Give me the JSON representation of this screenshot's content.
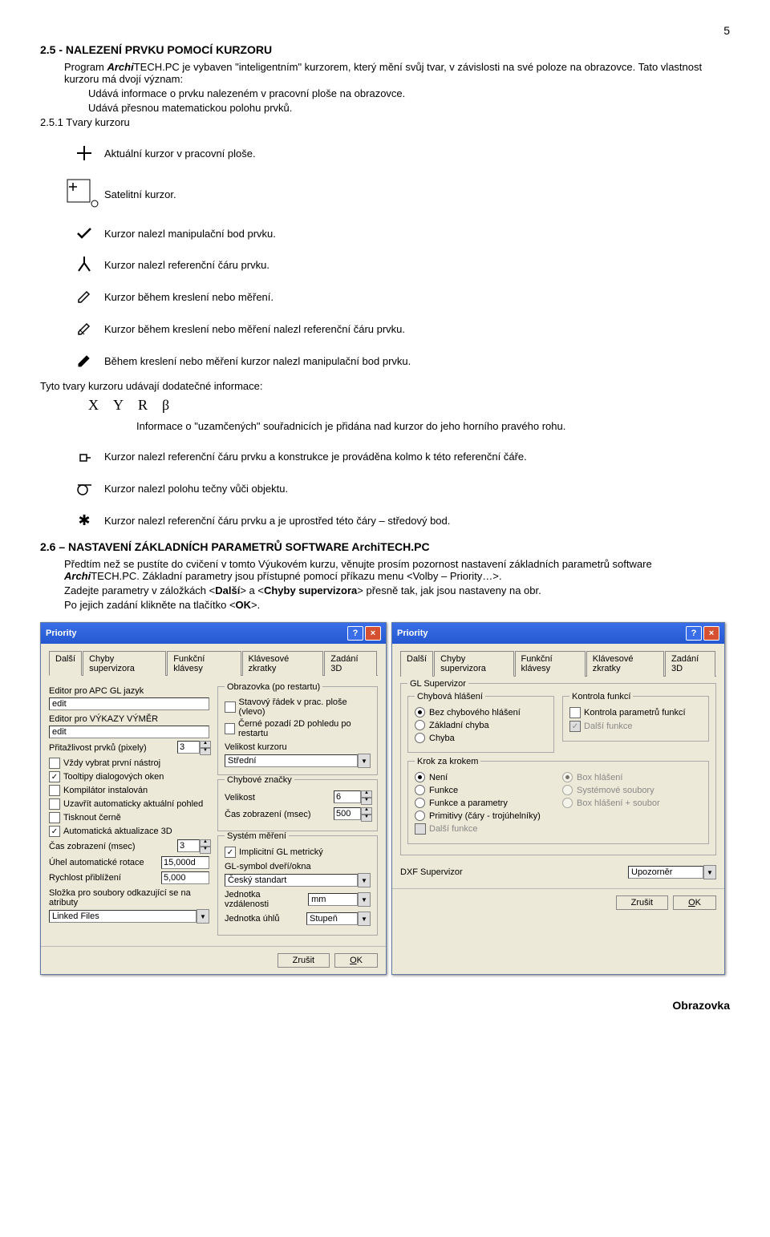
{
  "page_number": "5",
  "section_2_5": {
    "heading": "2.5 - NALEZENÍ PRVKU POMOCÍ KURZORU",
    "para1a": "Program ",
    "para1b": "Archi",
    "para1c": "TECH.PC je vybaven \"inteligentním\" kurzorem, který mění svůj tvar, v závislosti na své poloze na obrazovce. Tato vlastnost kurzoru má dvojí význam:",
    "bullet1": "Udává informace o prvku nalezeném v pracovní ploše na obrazovce.",
    "bullet2": "Udává přesnou matematickou polohu prvků.",
    "sub_heading": "2.5.1 Tvary kurzoru",
    "cursors": [
      "Aktuální kurzor v pracovní ploše.",
      "Satelitní kurzor.",
      "Kurzor nalezl manipulační bod prvku.",
      "Kurzor nalezl referenční čáru prvku.",
      "Kurzor během kreslení nebo měření.",
      "Kurzor během kreslení nebo měření nalezl referenční čáru prvku.",
      "Během kreslení nebo měření kurzor nalezl manipulační bod prvku."
    ],
    "info_line": "Tyto tvary kurzoru udávají dodatečné informace:",
    "info_icons": [
      "X",
      "Y",
      "R",
      "β"
    ],
    "info_desc": "Informace o \"uzamčených\" souřadnicích je přidána nad kurzor do jeho horního pravého rohu.",
    "extra": [
      "Kurzor nalezl referenční čáru prvku a konstrukce je prováděna kolmo k této referenční čáře.",
      "Kurzor nalezl polohu tečny vůči objektu.",
      "Kurzor nalezl referenční čáru prvku a je uprostřed této čáry – středový bod."
    ]
  },
  "section_2_6": {
    "heading": "2.6 – NASTAVENÍ ZÁKLADNÍCH PARAMETRŮ SOFTWARE ArchiTECH.PC",
    "para_a": "Předtím než se pustíte do cvičení v tomto Výukovém kurzu, věnujte prosím pozornost nastavení základních parametrů software ",
    "para_b": "Archi",
    "para_c": "TECH.PC. Základní parametry jsou přístupné pomocí příkazu menu <Volby – Priority…>.",
    "para2a": "Zadejte parametry v záložkách <",
    "para2b": "Další",
    "para2c": "> a <",
    "para2d": "Chyby supervizora",
    "para2e": "> přesně tak, jak jsou nastaveny na obr.",
    "para3": "Po jejich zadání klikněte na tlačítko <",
    "para3b": "OK",
    "para3c": ">."
  },
  "dialog_left": {
    "title": "Priority",
    "tabs": [
      "Další",
      "Chyby supervizora",
      "Funkční klávesy",
      "Klávesové zkratky",
      "Zadání 3D"
    ],
    "left_col": {
      "l1": "Editor pro APC GL jazyk",
      "v1": "edit",
      "l2": "Editor pro VÝKAZY VÝMĚR",
      "v2": "edit",
      "l3": "Přitažlivost prvků (pixely)",
      "v3": "3",
      "chk_first": "Vždy vybrat první nástroj",
      "chk_tooltip": "Tooltipy dialogových oken",
      "chk_comp": "Kompilátor instalován",
      "chk_close": "Uzavřít automaticky aktuální pohled",
      "chk_print": "Tisknout černě",
      "chk_auto3d": "Automatická aktualizace 3D",
      "l_time": "Čas zobrazení (msec)",
      "v_time": "3",
      "l_angle": "Úhel automatické rotace",
      "v_angle": "15,000d",
      "l_zoom": "Rychlost přiblížení",
      "v_zoom": "5,000",
      "l_folder": "Složka pro soubory odkazující se na atributy",
      "v_folder": "Linked Files"
    },
    "right_col": {
      "g1": "Obrazovka (po restartu)",
      "chk_stav": "Stavový řádek v prac. ploše (vlevo)",
      "chk_cerne": "Černé pozadí 2D pohledu po restartu",
      "l_velkurz": "Velikost kurzoru",
      "v_velkurz": "Střední",
      "g2": "Chybové značky",
      "l_vel": "Velikost",
      "v_vel": "6",
      "l_cas2": "Čas zobrazení (msec)",
      "v_cas2": "500",
      "g3": "Systém měření",
      "chk_impl": "Implicitní GL metrický",
      "l_glsym": "GL-symbol dveří/okna",
      "v_glsym": "Český standart",
      "l_jvzd": "Jednotka vzdálenosti",
      "v_jvzd": "mm",
      "l_juhl": "Jednotka úhlů",
      "v_juhl": "Stupeň"
    },
    "btn_cancel": "Zrušit",
    "btn_ok": "OK"
  },
  "dialog_right": {
    "title": "Priority",
    "tabs": [
      "Další",
      "Chyby supervizora",
      "Funkční klávesy",
      "Klávesové zkratky",
      "Zadání 3D"
    ],
    "g_gl": "GL Supervizor",
    "g_chh": "Chybová hlášení",
    "r_bez": "Bez chybového hlášení",
    "r_zakl": "Základní chyba",
    "r_chyba": "Chyba",
    "g_kf": "Kontrola funkcí",
    "chk_kpf": "Kontrola parametrů funkcí",
    "chk_df": "Další funkce",
    "g_kzk": "Krok za krokem",
    "r_neni": "Není",
    "r_funkce": "Funkce",
    "r_fap": "Funkce a parametry",
    "r_prim": "Primitivy (čáry - trojúhelníky)",
    "chk_df2": "Další funkce",
    "r_box": "Box hlášení",
    "r_sys": "Systémové soubory",
    "r_boxs": "Box hlášení + soubor",
    "l_dxf": "DXF Supervizor",
    "v_dxf": "Upozorněr",
    "btn_cancel": "Zrušit",
    "btn_ok": "OK"
  },
  "footer": "Obrazovka"
}
